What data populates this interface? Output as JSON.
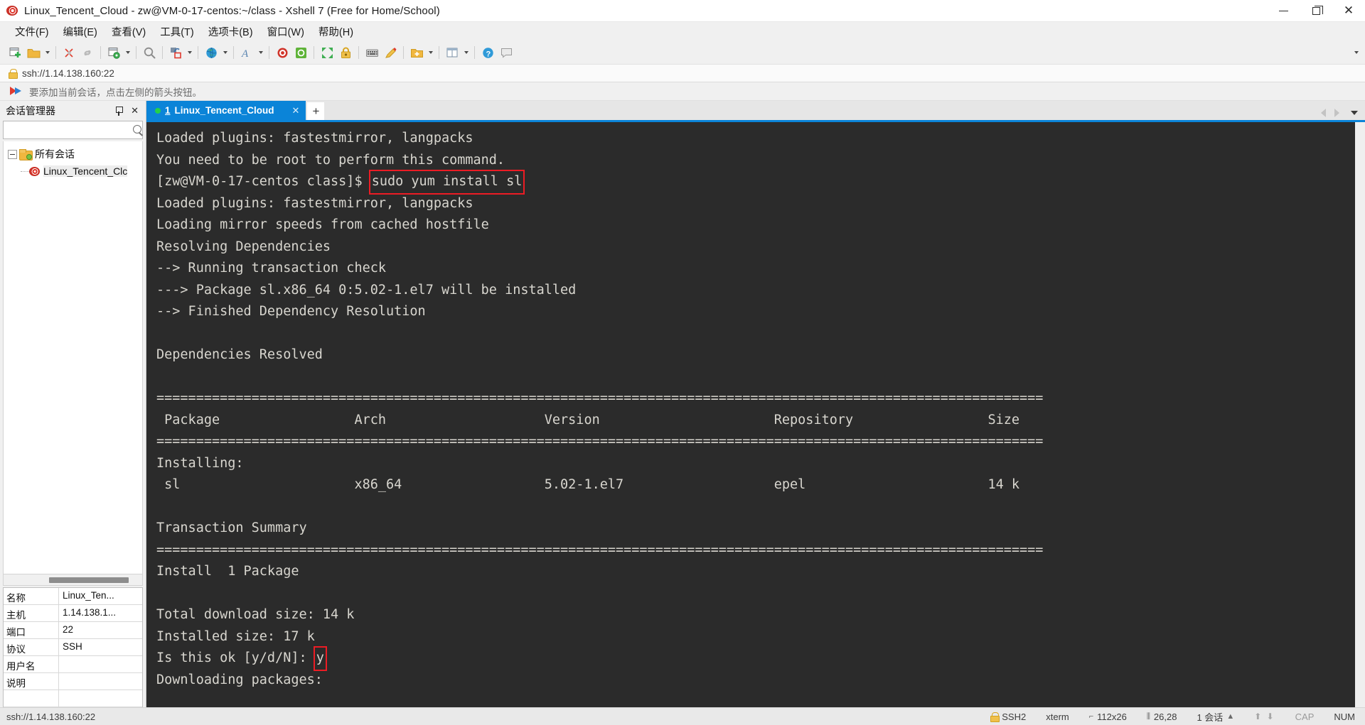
{
  "window": {
    "title": "Linux_Tencent_Cloud - zw@VM-0-17-centos:~/class - Xshell 7 (Free for Home/School)",
    "app_icon": "snail-icon",
    "minimize_label": "—",
    "maximize_label": "❐",
    "close_label": "✕"
  },
  "menubar": {
    "items": [
      {
        "label": "文件(F)",
        "name": "menu-file"
      },
      {
        "label": "编辑(E)",
        "name": "menu-edit"
      },
      {
        "label": "查看(V)",
        "name": "menu-view"
      },
      {
        "label": "工具(T)",
        "name": "menu-tools"
      },
      {
        "label": "选项卡(B)",
        "name": "menu-tab"
      },
      {
        "label": "窗口(W)",
        "name": "menu-window"
      },
      {
        "label": "帮助(H)",
        "name": "menu-help"
      }
    ]
  },
  "toolbar": {
    "icons": [
      "new-session-icon",
      "open-folder-icon",
      "disconnect-icon",
      "reconnect-icon",
      "session-properties-icon",
      "find-icon",
      "transfer-file-icon",
      "globe-icon",
      "font-icon",
      "xshell-icon",
      "xftp-icon",
      "fullscreen-icon",
      "lock-icon",
      "keyboard-icon",
      "highlight-icon",
      "add-folder-icon"
    ]
  },
  "address_bar": {
    "icon": "lock-icon",
    "url": "ssh://1.14.138.160:22"
  },
  "notice_bar": {
    "icon": "red-blue-arrow-icon",
    "text": "要添加当前会话，点击左侧的箭头按钮。"
  },
  "sidebar": {
    "title": "会话管理器",
    "pin_icon": "pin-icon",
    "close_icon": "close-icon",
    "search": {
      "value": "",
      "placeholder": "",
      "icon": "search-icon"
    },
    "tree": {
      "root": {
        "label": "所有会话",
        "icon": "folder-icon",
        "expanded": true
      },
      "children": [
        {
          "label": "Linux_Tencent_Clc",
          "icon": "snail-icon",
          "selected": true
        }
      ]
    },
    "properties": {
      "rows": [
        {
          "key": "名称",
          "value": "Linux_Ten..."
        },
        {
          "key": "主机",
          "value": "1.14.138.1..."
        },
        {
          "key": "端口",
          "value": "22"
        },
        {
          "key": "协议",
          "value": "SSH"
        },
        {
          "key": "用户名",
          "value": ""
        },
        {
          "key": "说明",
          "value": ""
        }
      ]
    }
  },
  "tabs": {
    "items": [
      {
        "number": "1",
        "label": "Linux_Tencent_Cloud",
        "active": true,
        "status_dot": "#25d04a",
        "close_label": "✕"
      }
    ],
    "new_tab_label": "+",
    "scroll_left_icon": "chevron-left-icon",
    "scroll_right_icon": "chevron-right-icon",
    "tab_list_icon": "chevron-down-icon"
  },
  "terminal": {
    "background": "#2b2b2b",
    "foreground": "#d8d6cf",
    "highlight_color": "#ec1c24",
    "lines": [
      {
        "text": "Loaded plugins: fastestmirror, langpacks"
      },
      {
        "text": "You need to be root to perform this command."
      },
      {
        "prompt": "[zw@VM-0-17-centos class]$ ",
        "command": "sudo yum install sl",
        "highlighted": true
      },
      {
        "text": "Loaded plugins: fastestmirror, langpacks"
      },
      {
        "text": "Loading mirror speeds from cached hostfile"
      },
      {
        "text": "Resolving Dependencies"
      },
      {
        "text": "--> Running transaction check"
      },
      {
        "text": "---> Package sl.x86_64 0:5.02-1.el7 will be installed"
      },
      {
        "text": "--> Finished Dependency Resolution"
      },
      {
        "text": ""
      },
      {
        "text": "Dependencies Resolved"
      },
      {
        "text": ""
      },
      {
        "text": "================================================================================================================"
      },
      {
        "text": " Package                 Arch                    Version                      Repository                 Size"
      },
      {
        "text": "================================================================================================================"
      },
      {
        "text": "Installing:"
      },
      {
        "text": " sl                      x86_64                  5.02-1.el7                   epel                       14 k"
      },
      {
        "text": ""
      },
      {
        "text": "Transaction Summary"
      },
      {
        "text": "================================================================================================================"
      },
      {
        "text": "Install  1 Package"
      },
      {
        "text": ""
      },
      {
        "text": "Total download size: 14 k"
      },
      {
        "text": "Installed size: 17 k"
      }
    ],
    "confirm_line": {
      "prompt": "Is this ok [y/d/N]: ",
      "answer": "y",
      "highlighted": true
    },
    "last_line": "Downloading packages:"
  },
  "statusbar": {
    "url": "ssh://1.14.138.160:22",
    "protocol": "SSH2",
    "terminal_type": "xterm",
    "size": "112x26",
    "cursor": "26,28",
    "sessions": "1 会话",
    "caps": "CAP",
    "num": "NUM",
    "lock_icon": "lock-icon",
    "size_icon": "resize-icon",
    "cursor_icon": "cursor-icon",
    "sessions_caret": "▲",
    "transfer_icons": "⬆ ⬇"
  }
}
